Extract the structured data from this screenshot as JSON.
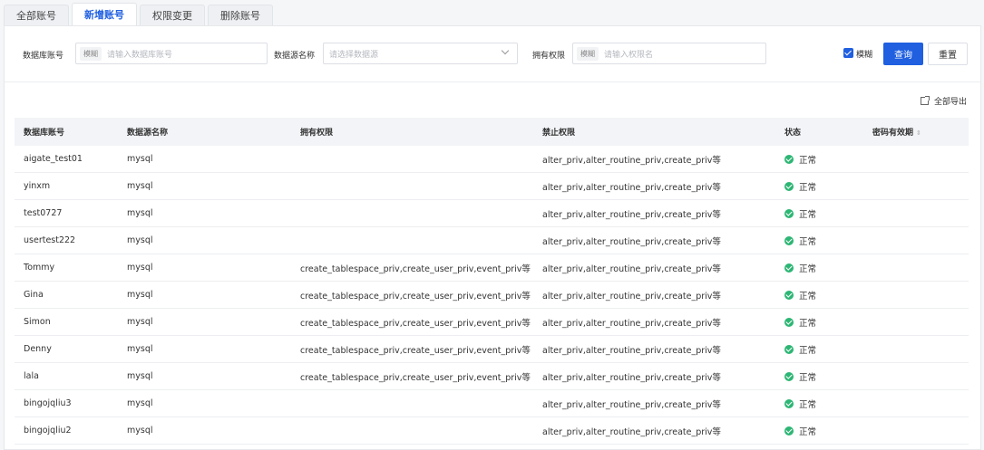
{
  "tabs": [
    {
      "label": "全部账号",
      "active": false
    },
    {
      "label": "新增账号",
      "active": true
    },
    {
      "label": "权限变更",
      "active": false
    },
    {
      "label": "删除账号",
      "active": false
    }
  ],
  "filters": {
    "db_account_label": "数据库账号",
    "db_account_tag": "模糊",
    "db_account_placeholder": "请输入数据库账号",
    "datasource_label": "数据源名称",
    "datasource_placeholder": "请选择数据源",
    "priv_label": "拥有权限",
    "priv_tag": "模糊",
    "priv_placeholder": "请输入权限名",
    "fuzzy_label": "模糊",
    "fuzzy_checked": true,
    "query_button": "查询",
    "reset_button": "重置"
  },
  "export_label": "全部导出",
  "table": {
    "headers": [
      "数据库账号",
      "数据源名称",
      "拥有权限",
      "禁止权限",
      "状态",
      "密码有效期"
    ],
    "rows": [
      {
        "account": "aigate_test01",
        "source": "mysql",
        "granted": "",
        "denied": "alter_priv,alter_routine_priv,create_priv等",
        "status": "正常",
        "expiry": ""
      },
      {
        "account": "yinxm",
        "source": "mysql",
        "granted": "",
        "denied": "alter_priv,alter_routine_priv,create_priv等",
        "status": "正常",
        "expiry": ""
      },
      {
        "account": "test0727",
        "source": "mysql",
        "granted": "",
        "denied": "alter_priv,alter_routine_priv,create_priv等",
        "status": "正常",
        "expiry": ""
      },
      {
        "account": "usertest222",
        "source": "mysql",
        "granted": "",
        "denied": "alter_priv,alter_routine_priv,create_priv等",
        "status": "正常",
        "expiry": ""
      },
      {
        "account": "Tommy",
        "source": "mysql",
        "granted": "create_tablespace_priv,create_user_priv,event_priv等",
        "denied": "alter_priv,alter_routine_priv,create_priv等",
        "status": "正常",
        "expiry": ""
      },
      {
        "account": "Gina",
        "source": "mysql",
        "granted": "create_tablespace_priv,create_user_priv,event_priv等",
        "denied": "alter_priv,alter_routine_priv,create_priv等",
        "status": "正常",
        "expiry": ""
      },
      {
        "account": "Simon",
        "source": "mysql",
        "granted": "create_tablespace_priv,create_user_priv,event_priv等",
        "denied": "alter_priv,alter_routine_priv,create_priv等",
        "status": "正常",
        "expiry": ""
      },
      {
        "account": "Denny",
        "source": "mysql",
        "granted": "create_tablespace_priv,create_user_priv,event_priv等",
        "denied": "alter_priv,alter_routine_priv,create_priv等",
        "status": "正常",
        "expiry": ""
      },
      {
        "account": "lala",
        "source": "mysql",
        "granted": "create_tablespace_priv,create_user_priv,event_priv等",
        "denied": "alter_priv,alter_routine_priv,create_priv等",
        "status": "正常",
        "expiry": ""
      },
      {
        "account": "bingojqliu3",
        "source": "mysql",
        "granted": "",
        "denied": "alter_priv,alter_routine_priv,create_priv等",
        "status": "正常",
        "expiry": ""
      },
      {
        "account": "bingojqliu2",
        "source": "mysql",
        "granted": "",
        "denied": "alter_priv,alter_routine_priv,create_priv等",
        "status": "正常",
        "expiry": ""
      }
    ]
  },
  "colors": {
    "accent": "#1f5fe0",
    "status_ok": "#2db674"
  }
}
